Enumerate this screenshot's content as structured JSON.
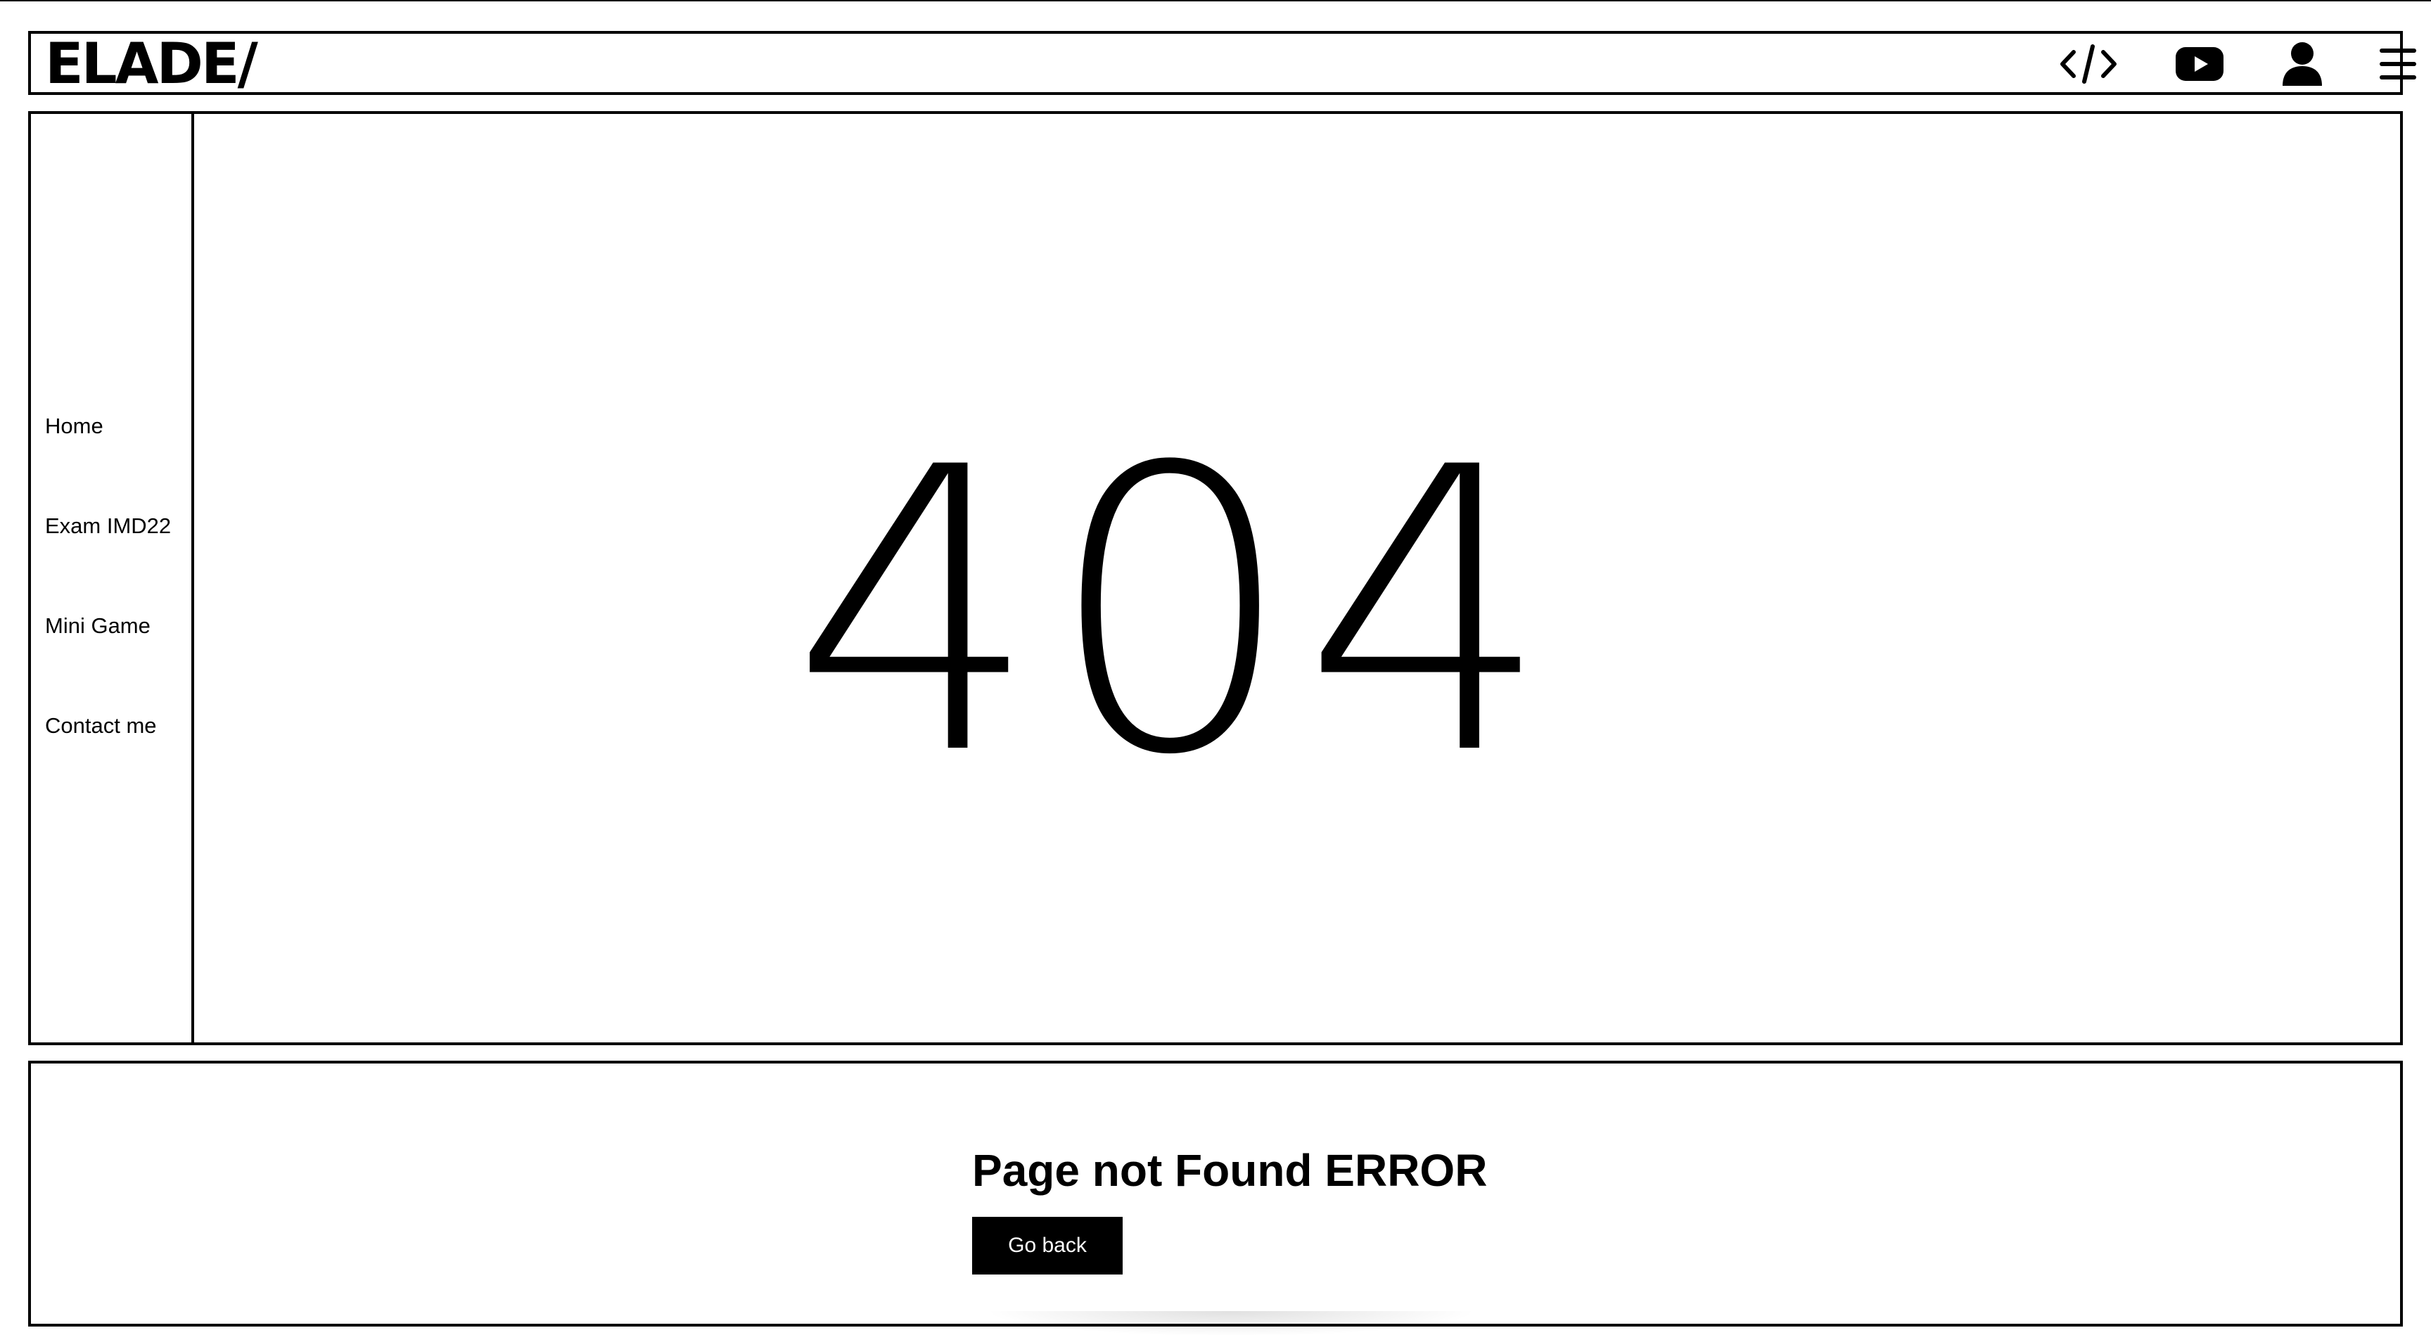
{
  "header": {
    "logo": "ELADE/",
    "icons": [
      "code-icon",
      "youtube-icon",
      "user-icon",
      "hamburger-menu-icon"
    ]
  },
  "sidebar": {
    "items": [
      {
        "label": "Home"
      },
      {
        "label": "Exam IMD22"
      },
      {
        "label": "Mini Game"
      },
      {
        "label": "Contact me"
      }
    ]
  },
  "main": {
    "error_code": "404"
  },
  "footer": {
    "title": "Page not Found ERROR",
    "button_label": "Go back"
  },
  "colors": {
    "background": "#ffffff",
    "foreground": "#000000",
    "button_text": "#ffffff"
  }
}
